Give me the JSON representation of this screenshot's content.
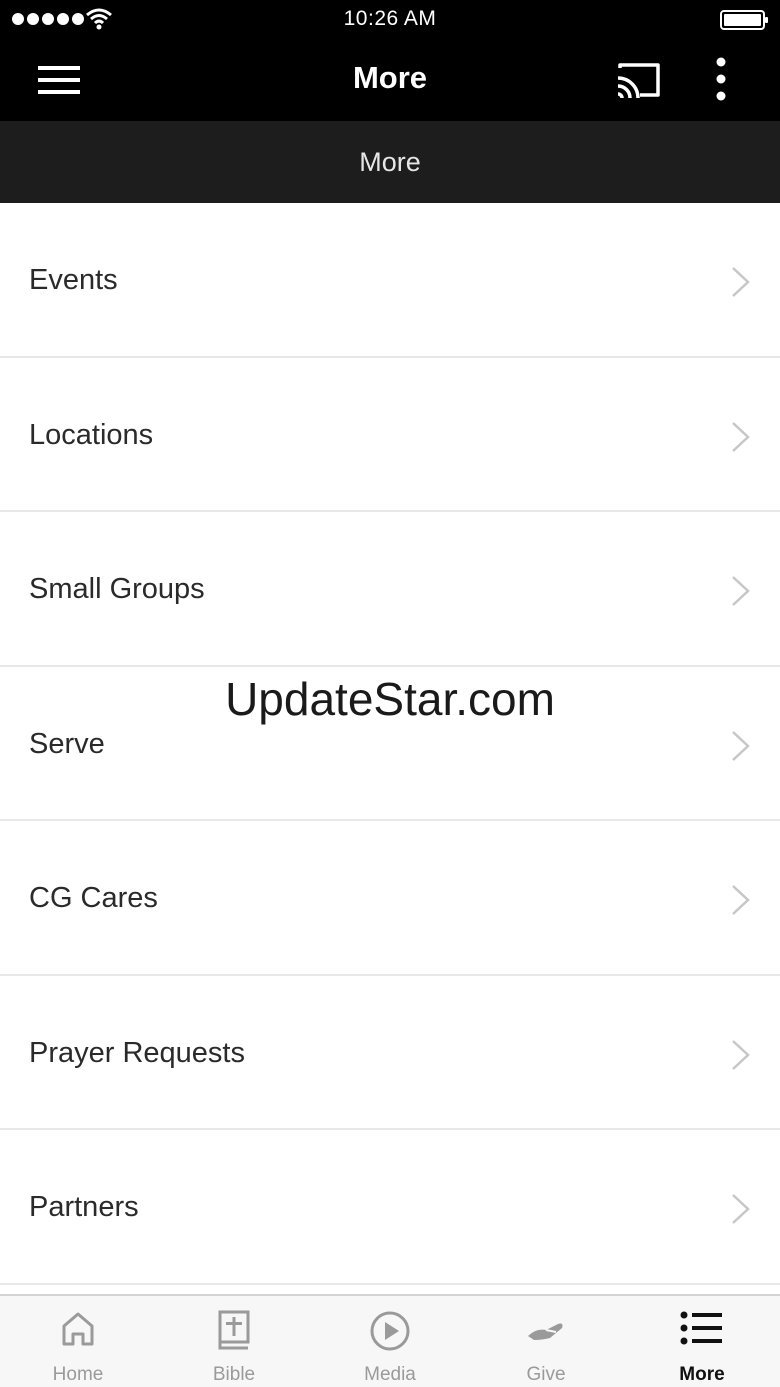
{
  "status_bar": {
    "time": "10:26 AM"
  },
  "nav": {
    "title": "More"
  },
  "sub_header": {
    "title": "More"
  },
  "list": {
    "items": [
      {
        "label": "Events"
      },
      {
        "label": "Locations"
      },
      {
        "label": "Small Groups"
      },
      {
        "label": "Serve"
      },
      {
        "label": "CG Cares"
      },
      {
        "label": "Prayer Requests"
      },
      {
        "label": "Partners"
      }
    ]
  },
  "watermark": "UpdateStar.com",
  "tabs": [
    {
      "label": "Home",
      "icon": "home-icon",
      "active": false
    },
    {
      "label": "Bible",
      "icon": "bible-icon",
      "active": false
    },
    {
      "label": "Media",
      "icon": "play-circle-icon",
      "active": false
    },
    {
      "label": "Give",
      "icon": "give-hand-icon",
      "active": false
    },
    {
      "label": "More",
      "icon": "list-icon",
      "active": true
    }
  ],
  "colors": {
    "header_bg": "#000000",
    "sub_header_bg": "#1d1d1d",
    "tab_inactive": "#9a9a9a",
    "tab_active": "#111111",
    "chevron": "#c7c7c7"
  }
}
